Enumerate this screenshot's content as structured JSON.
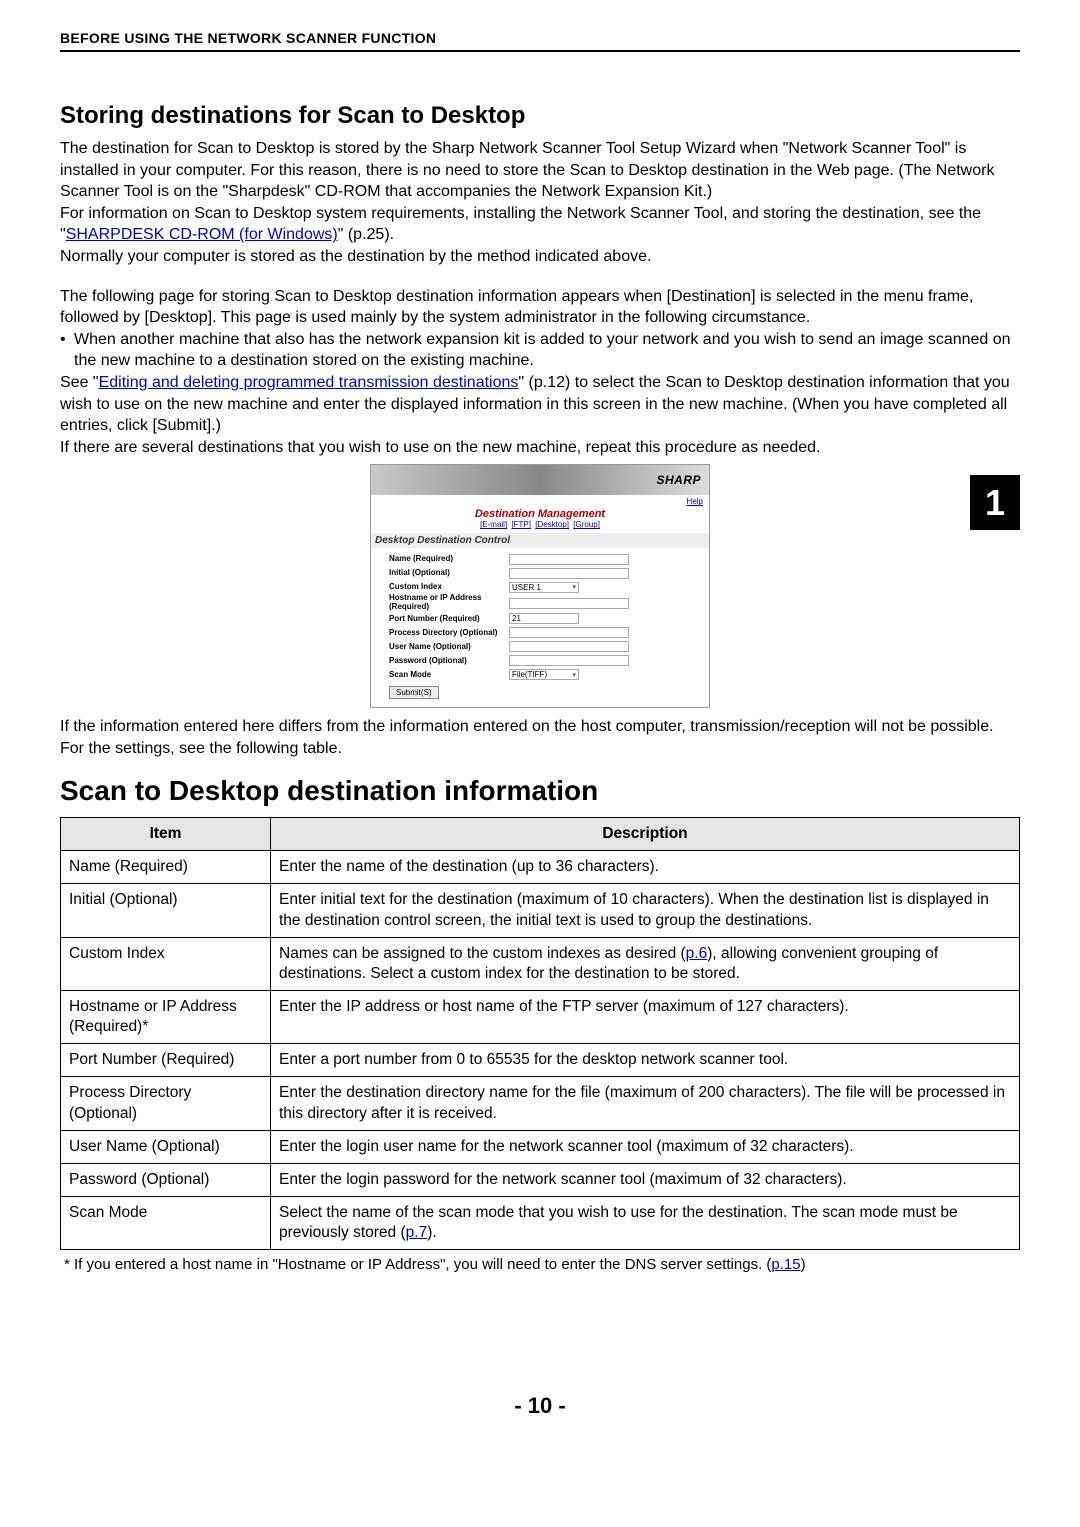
{
  "header": "BEFORE USING THE NETWORK SCANNER FUNCTION",
  "chapter_tab": "1",
  "section1_title": "Storing destinations for Scan to Desktop",
  "p1a": "The destination for Scan to Desktop is stored by the Sharp Network Scanner Tool Setup Wizard when \"Network Scanner Tool\" is installed in your computer. For this reason, there is no need to store the Scan to Desktop destination in the Web page. (The Network Scanner Tool is on the \"Sharpdesk\" CD-ROM that accompanies the Network Expansion Kit.)",
  "p1b_a": "For information on Scan to Desktop system requirements, installing the Network Scanner Tool, and storing the destination, see the \"",
  "p1b_link": "SHARPDESK CD-ROM (for Windows)",
  "p1b_c": "\" (p.25).",
  "p1c": "Normally your computer is stored as the destination by the method indicated above.",
  "p2": "The following page for storing Scan to Desktop destination information appears when [Destination] is selected in the menu frame, followed by [Desktop]. This page is used mainly by the system administrator in the following circumstance.",
  "bullet1": "When another machine that also has the network expansion kit is added to your network and you wish to send an image scanned on the new machine to a destination stored on the existing machine.",
  "p3a": "See  \"",
  "p3_link": "Editing and deleting programmed transmission destinations",
  "p3b": "\" (p.12) to select the Scan to Desktop destination information that you wish to use on the new machine and enter the displayed information in this screen in the new machine. (When you have completed all entries, click [Submit].)",
  "p4": "If there are several destinations that you wish to use on the new machine, repeat this procedure as needed.",
  "shot": {
    "brand": "SHARP",
    "help": "Help",
    "title": "Destination Management",
    "links": [
      "[E-mail]",
      "[FTP]",
      "[Desktop]",
      "[Group]"
    ],
    "subtitle": "Desktop Destination Control",
    "rows": {
      "name": "Name (Required)",
      "initial": "Initial (Optional)",
      "custom": "Custom Index",
      "custom_val": "USER 1",
      "host": "Hostname or IP Address (Required)",
      "port": "Port Number (Required)",
      "port_val": "21",
      "procdir": "Process Directory (Optional)",
      "uname": "User Name (Optional)",
      "pwd": "Password (Optional)",
      "scanmode": "Scan Mode",
      "scanmode_val": "File(TIFF)"
    },
    "submit": "Submit(S)"
  },
  "p5": "If the information entered here differs from the information entered on the host computer, transmission/reception will not be possible.",
  "p6": "For the settings, see the following table.",
  "section2_title": "Scan to Desktop destination information",
  "table": {
    "h_item": "Item",
    "h_desc": "Description",
    "rows": [
      {
        "item": "Name (Required)",
        "desc": "Enter the name of the destination (up to 36 characters)."
      },
      {
        "item": "Initial (Optional)",
        "desc": "Enter initial text for the destination (maximum of 10 characters). When the destination list is displayed in the destination control screen, the initial text is used to group the destinations."
      },
      {
        "item": "Custom Index",
        "desc_a": "Names can be assigned to the custom indexes as desired (",
        "link": "p.6",
        "desc_b": "), allowing convenient grouping of destinations. Select a custom index for the destination to be stored."
      },
      {
        "item": "Hostname or IP Address (Required)*",
        "desc": "Enter the IP address or host name of the FTP server (maximum of 127 characters)."
      },
      {
        "item": "Port Number (Required)",
        "desc": "Enter a port number from 0 to 65535 for the desktop network scanner tool."
      },
      {
        "item": "Process Directory (Optional)",
        "desc": "Enter the destination directory name for the file (maximum of 200 characters). The file will be processed in this directory after it is received."
      },
      {
        "item": "User Name (Optional)",
        "desc": "Enter the login user name for the network scanner tool (maximum of 32 characters)."
      },
      {
        "item": "Password (Optional)",
        "desc": "Enter the login password for the network scanner tool (maximum of 32 characters)."
      },
      {
        "item": "Scan Mode",
        "desc_a": "Select the name of the scan mode that you wish to use for the destination. The scan mode must be previously stored (",
        "link": "p.7",
        "desc_b": ")."
      }
    ]
  },
  "footnote_a": "* If you entered a host name in \"Hostname or IP Address\", you will need to enter the DNS server settings. (",
  "footnote_link": "p.15",
  "footnote_b": ")",
  "page_number": "- 10 -"
}
